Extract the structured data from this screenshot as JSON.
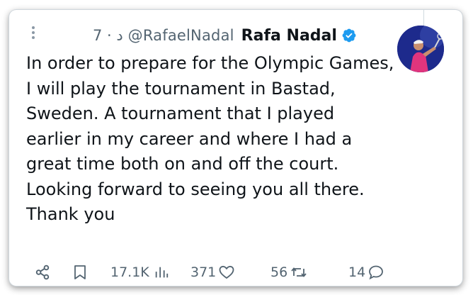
{
  "tweet": {
    "time": "7 · د",
    "handle": "@RafaelNadal",
    "display_name": "Rafa Nadal",
    "text": "In order to prepare for the Olympic Games, I will play the tournament in Bastad, Sweden. A tournament that I played earlier in my career and where I had a great time both on and off the court. Looking forward to seeing you all there.\nThank you"
  },
  "stats": {
    "views": "17.1K",
    "likes": "371",
    "retweets": "56",
    "replies": "14"
  },
  "icons": {
    "verified": "verified-badge-icon",
    "share": "share-icon",
    "bookmark": "bookmark-icon",
    "views": "analytics-icon",
    "like": "heart-icon",
    "retweet": "retweet-icon",
    "reply": "reply-icon",
    "more": "more-vertical-icon"
  },
  "colors": {
    "verified": "#1d9bf0",
    "text": "#0f1419",
    "muted": "#536471"
  }
}
